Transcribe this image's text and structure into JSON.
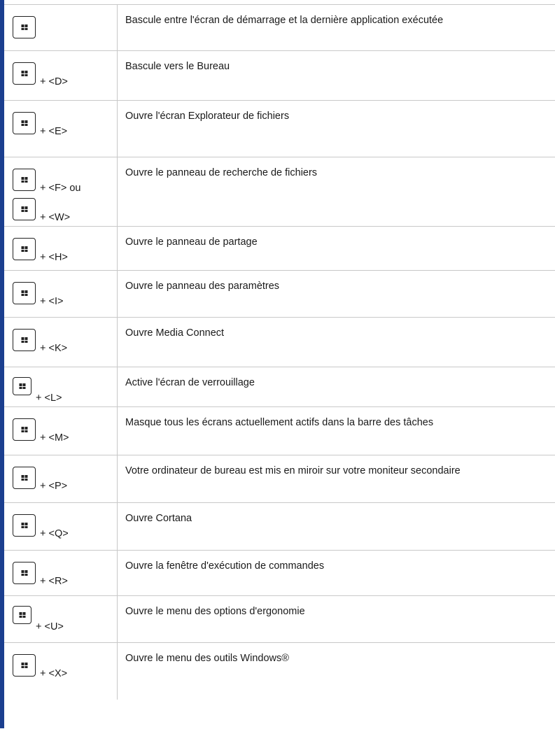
{
  "rows": [
    {
      "keys": [
        {
          "suffix": ""
        }
      ],
      "desc": "Bascule entre l'écran de démarrage et la dernière application exécutée"
    },
    {
      "keys": [
        {
          "suffix": "+ <D>"
        }
      ],
      "desc": "Bascule vers le Bureau"
    },
    {
      "keys": [
        {
          "suffix": "+ <E>"
        }
      ],
      "desc": "Ouvre l'écran Explorateur de fichiers"
    },
    {
      "keys": [
        {
          "suffix": "+ <F> ou"
        },
        {
          "suffix": "+ <W>"
        }
      ],
      "desc": "Ouvre le panneau de recherche de fichiers"
    },
    {
      "keys": [
        {
          "suffix": "+ <H>"
        }
      ],
      "desc": "Ouvre le panneau de partage"
    },
    {
      "keys": [
        {
          "suffix": "+ <I>"
        }
      ],
      "desc": "Ouvre le panneau des paramètres"
    },
    {
      "keys": [
        {
          "suffix": "+ <K>"
        }
      ],
      "desc": "Ouvre Media Connect"
    },
    {
      "keys": [
        {
          "suffix": "+ <L>",
          "small": true
        }
      ],
      "desc": "Active l'écran de verrouillage"
    },
    {
      "keys": [
        {
          "suffix": "+ <M>"
        }
      ],
      "desc": "Masque tous les écrans actuellement actifs dans la barre des tâches"
    },
    {
      "keys": [
        {
          "suffix": "+ <P>"
        }
      ],
      "desc": "Votre ordinateur de bureau est mis en miroir sur votre moniteur secondaire"
    },
    {
      "keys": [
        {
          "suffix": "+ <Q>"
        }
      ],
      "desc": "Ouvre Cortana"
    },
    {
      "keys": [
        {
          "suffix": "+ <R>"
        }
      ],
      "desc": "Ouvre la fenêtre d'exécution de commandes"
    },
    {
      "keys": [
        {
          "suffix": "+ <U>",
          "small": true
        }
      ],
      "desc": "Ouvre le menu des options d'ergonomie"
    },
    {
      "keys": [
        {
          "suffix": "+ <X>"
        }
      ],
      "desc": "Ouvre le menu des outils Windows®"
    }
  ],
  "icons": {
    "key": "windows-key-icon"
  },
  "colors": {
    "accent": "#1b3f8f",
    "border": "#c8c8c8"
  }
}
